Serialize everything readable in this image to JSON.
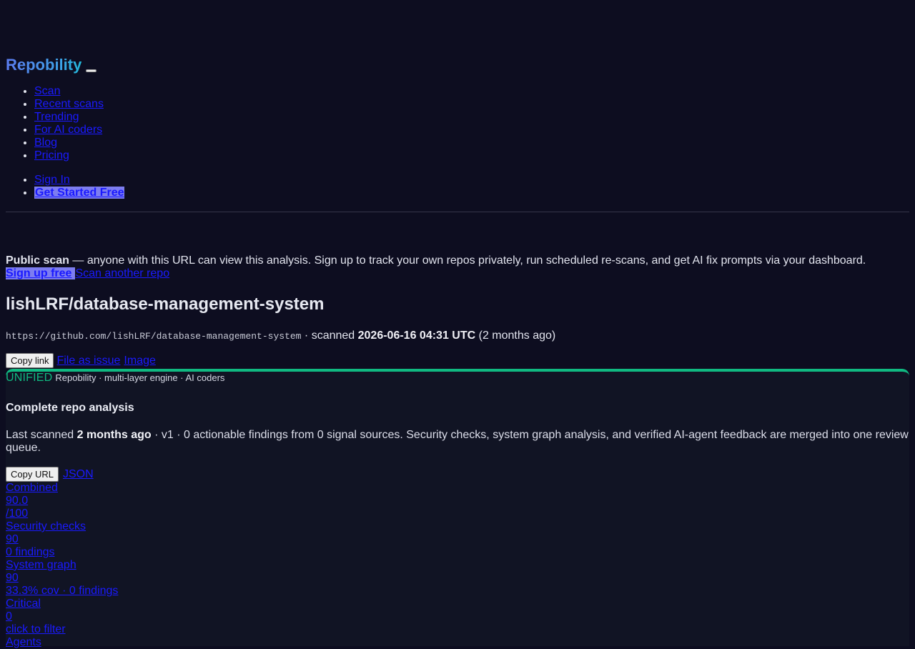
{
  "header": {
    "brand": "Repobility",
    "nav": [
      "Scan",
      "Recent scans",
      "Trending",
      "For AI coders",
      "Blog",
      "Pricing"
    ],
    "sign_in": "Sign In",
    "get_started": "Get Started Free"
  },
  "notice": {
    "strong": "Public scan",
    "text": " — anyone with this URL can view this analysis. Sign up to track your own repos privately, run scheduled re-scans, and get AI fix prompts via your dashboard.",
    "signup": "Sign up free",
    "scan_another": "Scan another repo"
  },
  "repo": {
    "title": "lishLRF/database-management-system",
    "url": "https://github.com/lishLRF/database-management-system",
    "scanned_prefix": " · scanned ",
    "scanned_at": "2026-06-16 04:31 UTC",
    "scanned_rel": " (2 months ago)",
    "copy_link": "Copy link",
    "file_issue": "File as issue",
    "image": "Image"
  },
  "card": {
    "tag": "UNIFIED",
    "engine": "Repobility · multi-layer engine · AI coders",
    "heading": "Complete repo analysis",
    "summary_prefix": "Last scanned ",
    "summary_when": "2 months ago",
    "summary_rest": " · v1 · 0 actionable findings from 0 signal sources. Security checks, system graph analysis, and verified AI-agent feedback are merged into one review queue.",
    "copy_url": "Copy URL",
    "json": "JSON"
  },
  "metrics": [
    "Combined",
    "90.0",
    "/100",
    "Security checks",
    "90",
    "0 findings",
    "System graph",
    "90",
    "33.3% cov · 0 findings",
    "Critical",
    "0",
    "click to filter",
    "Agents"
  ]
}
